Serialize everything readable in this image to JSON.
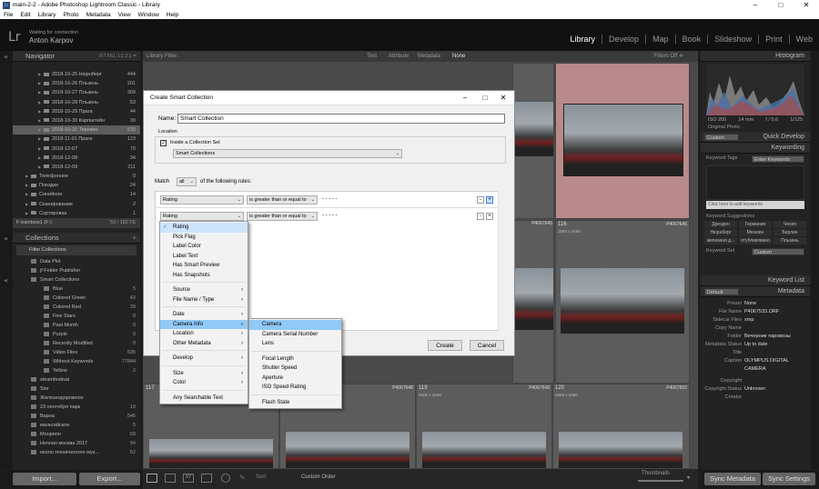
{
  "window": {
    "title": "main-2-2 - Adobe Photoshop Lightroom Classic - Library",
    "minimize": "–",
    "maximize": "□",
    "close": "✕"
  },
  "menubar": [
    "File",
    "Edit",
    "Library",
    "Photo",
    "Metadata",
    "View",
    "Window",
    "Help"
  ],
  "identity": {
    "logo": "Lr",
    "status": "Waiting for connection",
    "name": "Anton Karpov"
  },
  "modules": [
    "Library",
    "Develop",
    "Map",
    "Book",
    "Slideshow",
    "Print",
    "Web"
  ],
  "navigator": {
    "title": "Navigator",
    "zoom": "FIT   FILL   1:1   2:1  ≑"
  },
  "folders": [
    {
      "name": "2018-10-25 Нюрнберг",
      "count": "444"
    },
    {
      "name": "2018-10-26 Пльзень",
      "count": "201"
    },
    {
      "name": "2018-10-27 Пльзень",
      "count": "309"
    },
    {
      "name": "2018-10-28 Пльзень",
      "count": "53"
    },
    {
      "name": "2018-10-29 Прага",
      "count": "44"
    },
    {
      "name": "2018-10-30 Карлштейн",
      "count": "39"
    },
    {
      "name": "2018-10-31 Терезин",
      "count": "530"
    },
    {
      "name": "2018-11-01 Прага",
      "count": "123"
    },
    {
      "name": "2018-12-07",
      "count": "70"
    },
    {
      "name": "2018-12-08",
      "count": "34"
    },
    {
      "name": "2018-12-09",
      "count": "211"
    },
    {
      "name": "Телефонное",
      "count": "0"
    },
    {
      "name": "Поездки",
      "count": "24"
    },
    {
      "name": "Синейное",
      "count": "14"
    },
    {
      "name": "Сканирование",
      "count": "2"
    },
    {
      "name": "Сортировка",
      "count": "1"
    }
  ],
  "volume": {
    "name": "F:\\rainbow1 (F:)",
    "size": "53 / 182 ГБ"
  },
  "collections": {
    "title": "Collections",
    "filter": "Filter Collections",
    "items": [
      {
        "name": "Data Plot",
        "count": ""
      },
      {
        "name": "jf Folder Publisher",
        "count": ""
      },
      {
        "name": "Smart Collections",
        "count": ""
      },
      {
        "name": "Blue",
        "count": "5"
      },
      {
        "name": "Colored Green",
        "count": "43"
      },
      {
        "name": "Colored Red",
        "count": "29"
      },
      {
        "name": "Five Stars",
        "count": "0"
      },
      {
        "name": "Past Month",
        "count": "0"
      },
      {
        "name": "Purple",
        "count": "0"
      },
      {
        "name": "Recently Modified",
        "count": "0"
      },
      {
        "name": "Video Files",
        "count": "535"
      },
      {
        "name": "Without Keywords",
        "count": "77844"
      },
      {
        "name": "Yellow",
        "count": "2"
      },
      {
        "name": "steamfestival",
        "count": ""
      },
      {
        "name": "Sior",
        "count": ""
      },
      {
        "name": "Железнодорожное",
        "count": ""
      },
      {
        "name": "23 сентября парк",
        "count": "19"
      },
      {
        "name": "Варна",
        "count": "546"
      },
      {
        "name": "мальтийское",
        "count": "5"
      },
      {
        "name": "Монрепо",
        "count": "69"
      },
      {
        "name": "Ночная москва 2017",
        "count": "94"
      },
      {
        "name": "около технического муз...",
        "count": "62"
      }
    ]
  },
  "leftButtons": {
    "import": "Import...",
    "export": "Export..."
  },
  "filterbar": {
    "label": "Library Filter :",
    "opts": [
      "Text",
      "Attribute",
      "Metadata",
      "None"
    ],
    "off": "Filters Off ≑"
  },
  "grid": [
    {
      "num": "116",
      "id": "P4067646",
      "dim": "2560 x 3456",
      "ext": "JPG"
    },
    {
      "num": "",
      "id": "P4067645",
      "dim": "",
      "ext": "JPG"
    },
    {
      "num": "117",
      "id": "P4067648",
      "dim": "2560 x 3456",
      "ext": "JPG"
    },
    {
      "num": "119",
      "id": "P4067649",
      "dim": "4608 x 3456",
      "ext": "ORF+JPEG"
    },
    {
      "num": "120",
      "id": "P4067650",
      "dim": "4608 x 3456",
      "ext": "ORF+JPEG"
    }
  ],
  "toolbar": {
    "sort_label": "Sort:",
    "sort_value": "Custom Order",
    "thumbs": "Thumbnails"
  },
  "right": {
    "histogram": "Histogram",
    "hist_info": [
      "ISO 200",
      "14 mm",
      "f / 5.6",
      "1/125"
    ],
    "orig": "Original Photo",
    "quick": {
      "preset": "Custom",
      "title": "Quick Develop"
    },
    "keywording": "Keywording",
    "kwtags": "Keyword Tags",
    "kwmode": "Enter Keywords",
    "kwhint": "Click here to add keywords",
    "suggest": "Keyword Suggestions",
    "suggestions": [
      "Дрезден",
      "Германия",
      "Чехия",
      "Нюрнберг",
      "Мюнхен",
      "Берлин",
      "железная д...",
      "отубликовано",
      "Пльзень"
    ],
    "kwset": "Keyword Set",
    "kwset_val": "Custom",
    "kwlist": "Keyword List",
    "metadata": "Metadata",
    "md_preset_sel": "Default",
    "md": [
      {
        "k": "Preset",
        "v": "None"
      },
      {
        "k": "File Name",
        "v": "P4067533.ORF"
      },
      {
        "k": "Sidecar Files",
        "v": "xmp"
      },
      {
        "k": "Copy Name",
        "v": ""
      },
      {
        "k": "Folder",
        "v": "Вечерние паровозы"
      },
      {
        "k": "Metadata Status",
        "v": "Up to date"
      },
      {
        "k": "Title",
        "v": ""
      },
      {
        "k": "Caption",
        "v": "OLYMPUS DIGITAL CAMERA"
      },
      {
        "k": "Copyright",
        "v": ""
      },
      {
        "k": "Copyright Status",
        "v": "Unknown"
      },
      {
        "k": "Creator",
        "v": ""
      }
    ],
    "sync_md": "Sync Metadata",
    "sync_set": "Sync Settings"
  },
  "dialog": {
    "title": "Create Smart Collection",
    "name_label": "Name:",
    "name_value": "Smart Collection",
    "location_label": "Location",
    "inside_label": "Inside a Collection Set",
    "set_value": "Smart Collections",
    "match_label": "Match",
    "match_value": "all",
    "match_suffix": "of the following rules:",
    "rule1": {
      "field": "Rating",
      "op": "is greater than or equal to",
      "stars": "-  -  -  -  -"
    },
    "rule2": {
      "field": "Rating",
      "op": "is greater than or equal to",
      "stars": "-  -  -  -  -"
    },
    "create": "Create",
    "cancel": "Cancel"
  },
  "menu": [
    {
      "label": "Rating",
      "checked": true
    },
    {
      "label": "Pick Flag"
    },
    {
      "label": "Label Color"
    },
    {
      "label": "Label Text"
    },
    {
      "label": "Has Smart Preview"
    },
    {
      "label": "Has Snapshots"
    },
    {
      "sep": true
    },
    {
      "label": "Source",
      "sub": true
    },
    {
      "label": "File Name / Type",
      "sub": true
    },
    {
      "sep": true
    },
    {
      "label": "Date",
      "sub": true
    },
    {
      "label": "Camera Info",
      "sub": true,
      "hl": true
    },
    {
      "label": "Location",
      "sub": true
    },
    {
      "label": "Other Metadata",
      "sub": true
    },
    {
      "sep": true
    },
    {
      "label": "Develop",
      "sub": true
    },
    {
      "sep": true
    },
    {
      "label": "Size",
      "sub": true
    },
    {
      "label": "Color",
      "sub": true
    },
    {
      "sep": true
    },
    {
      "label": "Any Searchable Text"
    }
  ],
  "submenu": [
    {
      "label": "Camera",
      "hl": true
    },
    {
      "label": "Camera Serial Number"
    },
    {
      "label": "Lens"
    },
    {
      "sep": true
    },
    {
      "label": "Focal Length"
    },
    {
      "label": "Shutter Speed"
    },
    {
      "label": "Aperture"
    },
    {
      "label": "ISO Speed Rating"
    },
    {
      "sep": true
    },
    {
      "label": "Flash State"
    }
  ],
  "colors": {
    "accent": "#91c9f7",
    "selection": "#5d5d5d",
    "panel": "#232323"
  }
}
